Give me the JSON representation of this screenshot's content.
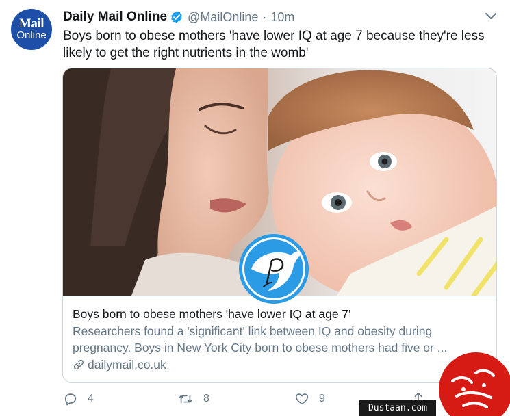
{
  "account": {
    "name": "Daily Mail Online",
    "handle": "@MailOnline",
    "separator": "·",
    "time": "10m",
    "avatar_line1": "Mail",
    "avatar_line2": "Online",
    "verified_icon": "verified-badge-icon",
    "brand_color": "#1d4fa8",
    "verified_color": "#1da1f2"
  },
  "tweet": {
    "text": "Boys born to obese mothers 'have lower IQ at age 7 because they're less likely to get the right nutrients in the womb'"
  },
  "card": {
    "title": "Boys born to obese mothers 'have lower IQ at age 7'",
    "description_line1": "Researchers found a 'significant' link between IQ and obesity during",
    "description_line2": "pregnancy. Boys in New York City born to obese mothers had five or ...",
    "domain": "dailymail.co.uk",
    "link_icon": "link-icon"
  },
  "actions": {
    "reply_count": "4",
    "retweet_count": "8",
    "like_count": "9"
  },
  "watermarks": {
    "site": "Dustaan.com",
    "seal_color": "#d61a14"
  }
}
